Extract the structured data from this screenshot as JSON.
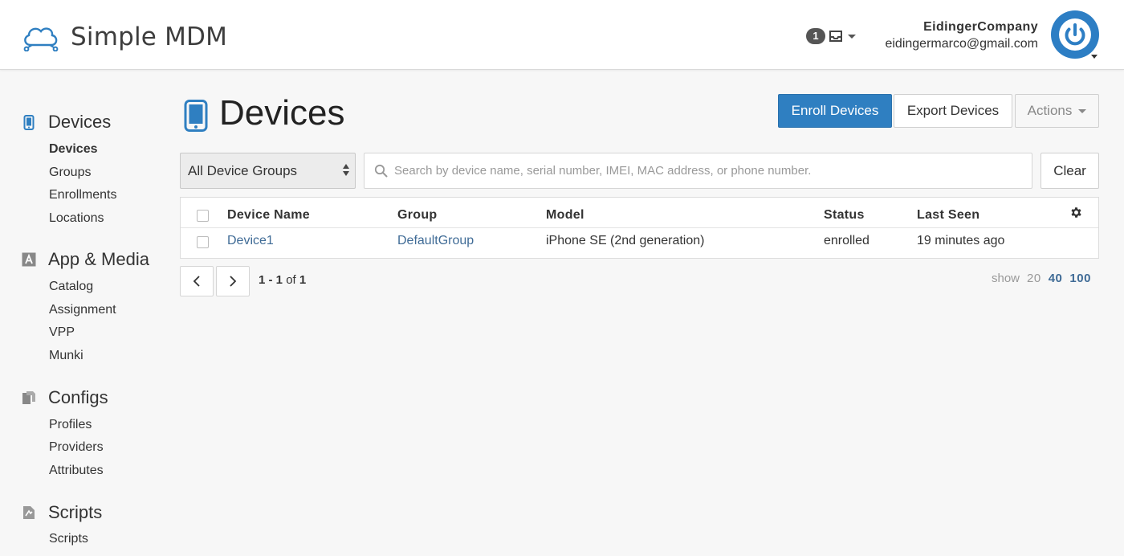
{
  "header": {
    "logo_text": "Simple MDM",
    "inbox_count": "1",
    "account_company": "EidingerCompany",
    "account_email": "eidingermarco@gmail.com"
  },
  "sidebar": {
    "sections": [
      {
        "label": "Devices",
        "icon": "phone-icon",
        "items": [
          "Devices",
          "Groups",
          "Enrollments",
          "Locations"
        ],
        "active": "Devices"
      },
      {
        "label": "App & Media",
        "icon": "app-store-icon",
        "items": [
          "Catalog",
          "Assignment",
          "VPP",
          "Munki"
        ]
      },
      {
        "label": "Configs",
        "icon": "documents-icon",
        "items": [
          "Profiles",
          "Providers",
          "Attributes"
        ]
      },
      {
        "label": "Scripts",
        "icon": "script-icon",
        "items": [
          "Scripts"
        ]
      }
    ]
  },
  "main": {
    "title": "Devices",
    "enroll_button": "Enroll Devices",
    "export_button": "Export Devices",
    "actions_button": "Actions",
    "group_filter": "All Device Groups",
    "search_placeholder": "Search by device name, serial number, IMEI, MAC address, or phone number.",
    "clear_button": "Clear",
    "table": {
      "columns": [
        "Device Name",
        "Group",
        "Model",
        "Status",
        "Last Seen"
      ],
      "rows": [
        {
          "name": "Device1",
          "group": "DefaultGroup",
          "model": "iPhone SE (2nd generation)",
          "status": "enrolled",
          "last_seen": "19 minutes ago"
        }
      ]
    },
    "pagination": {
      "range": "1 - 1",
      "of_label": "of",
      "total": "1",
      "show_label": "show",
      "page_sizes": [
        "20",
        "40",
        "100"
      ],
      "selected_size": "40"
    }
  },
  "colors": {
    "primary": "#2f7fc1",
    "link": "#3f6b96",
    "background": "#f7f7f7"
  }
}
